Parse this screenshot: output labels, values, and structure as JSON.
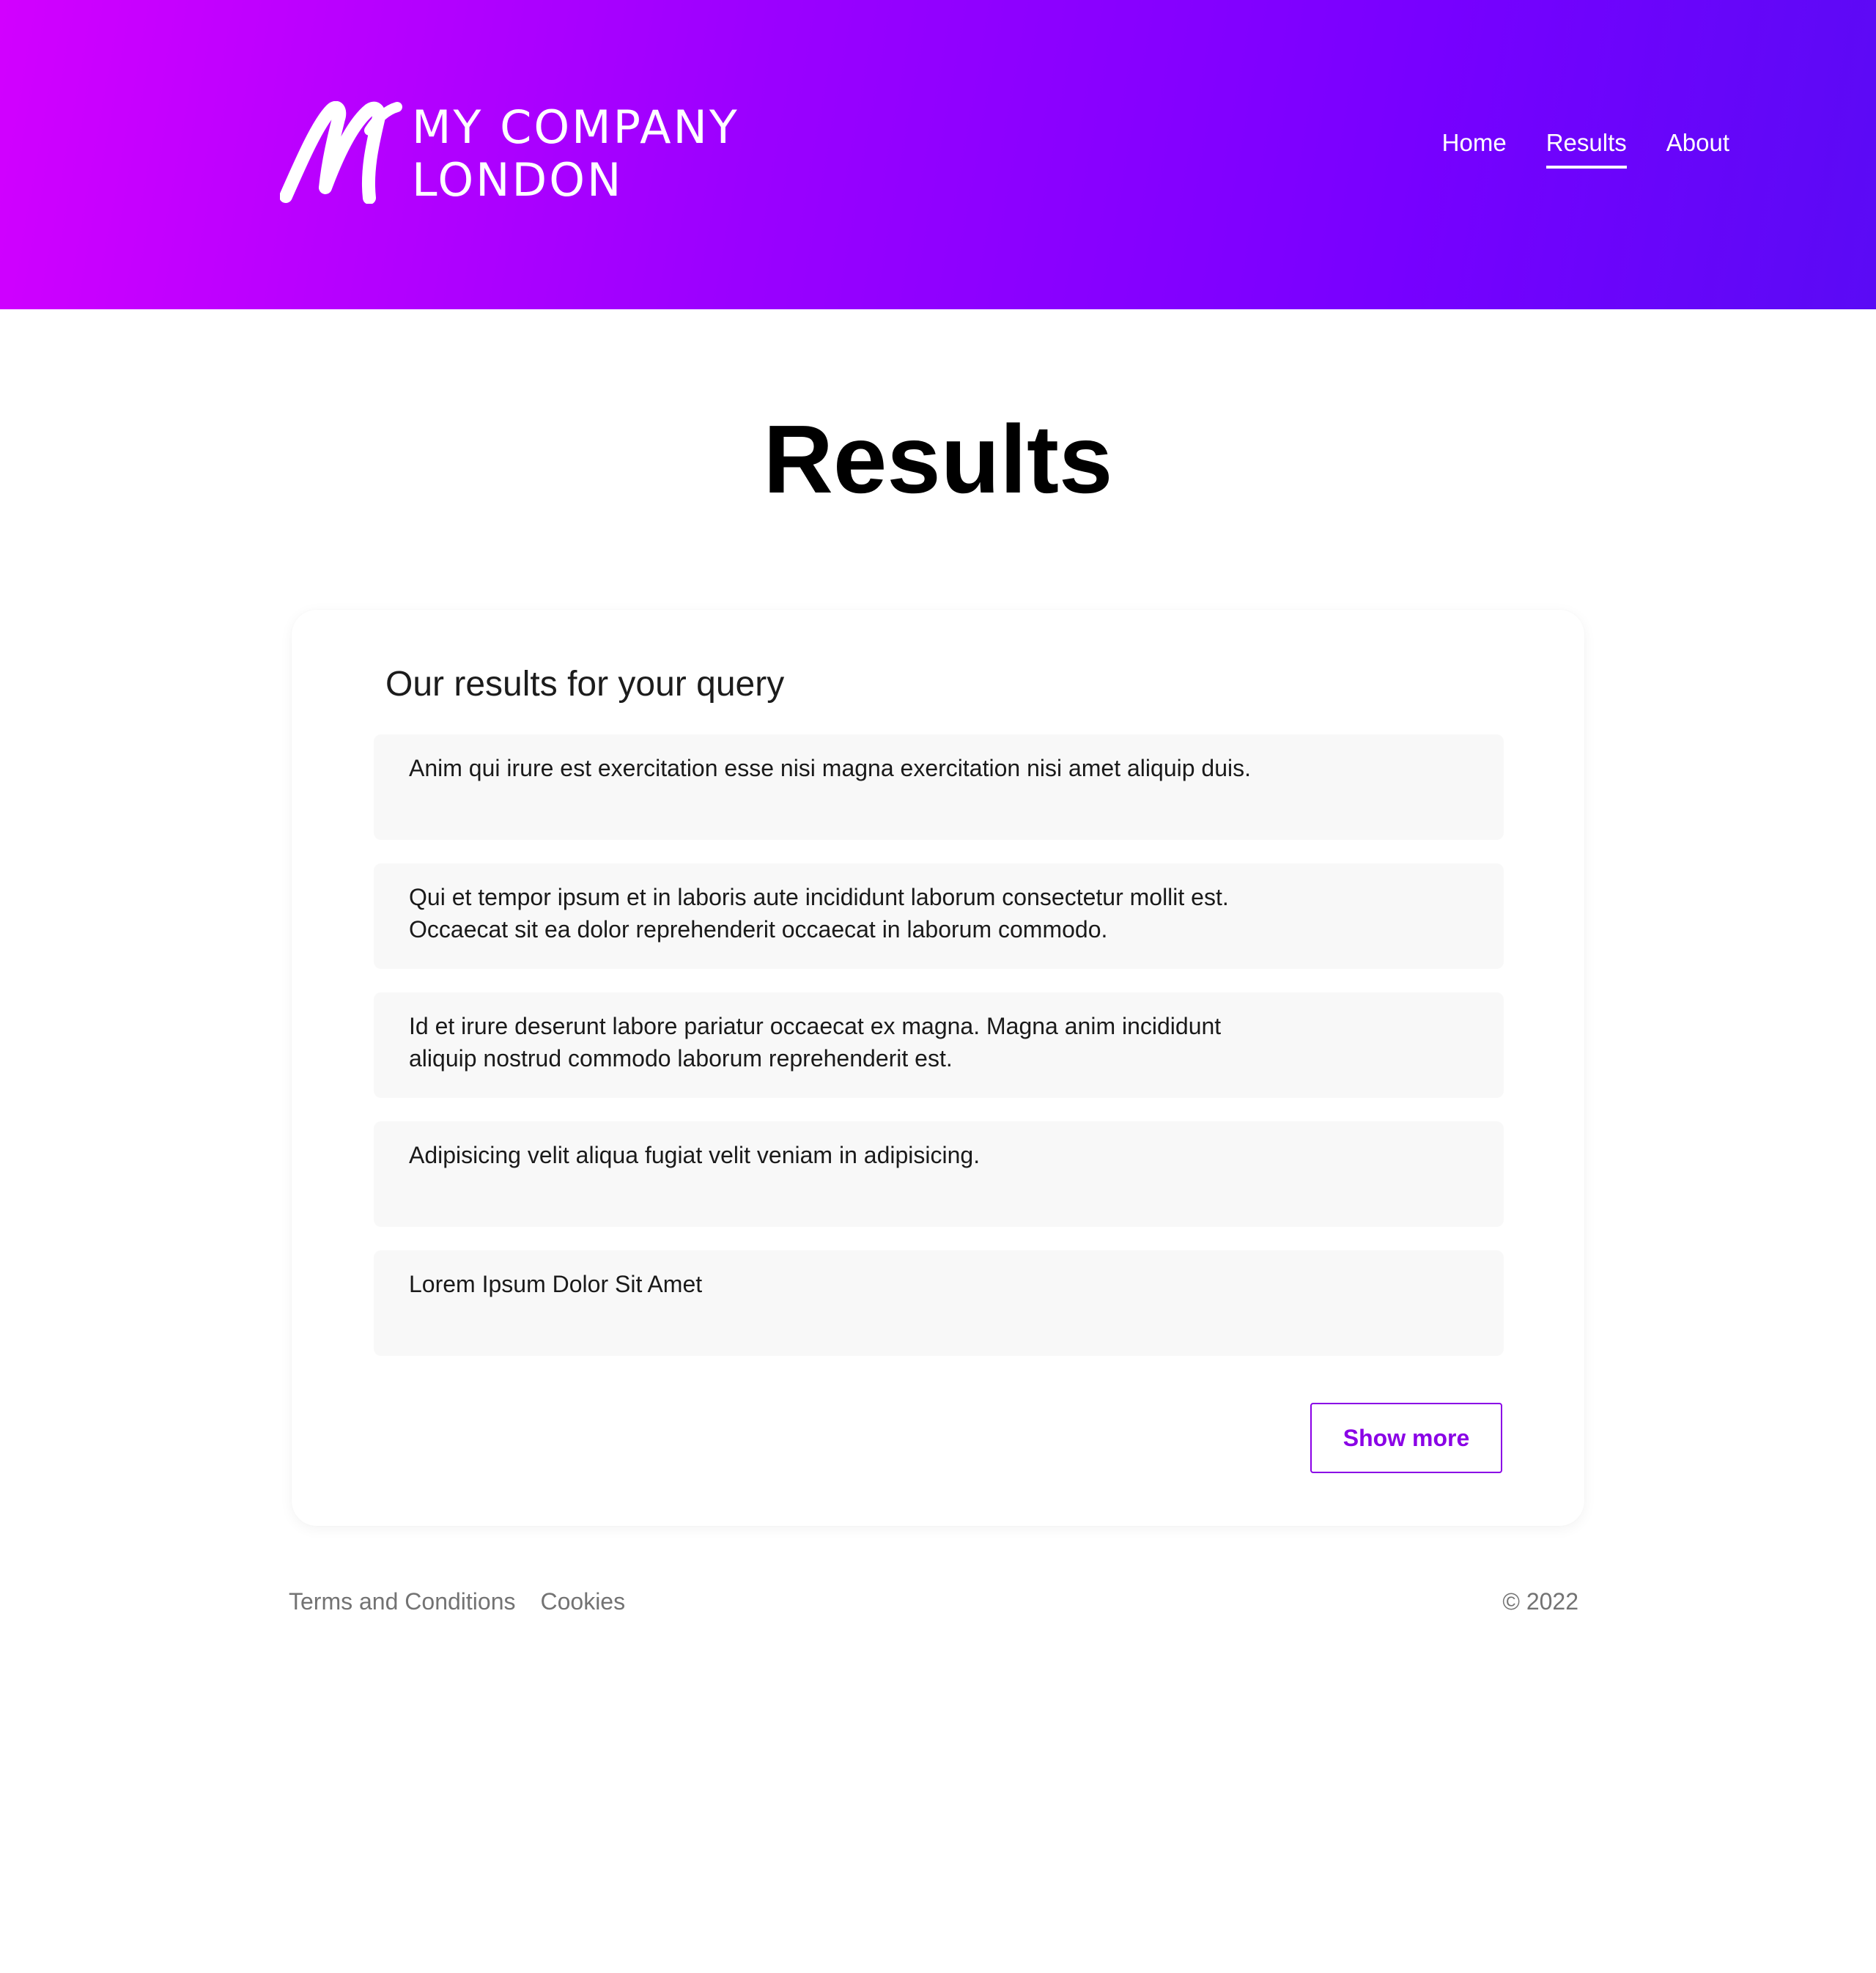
{
  "header": {
    "logo_line1": "MY COMPANY",
    "logo_line2": "LONDON",
    "nav": [
      {
        "label": "Home",
        "active": false
      },
      {
        "label": "Results",
        "active": true
      },
      {
        "label": "About",
        "active": false
      }
    ],
    "gradient_start": "#d200ff",
    "gradient_end": "#5a0af5"
  },
  "main": {
    "title": "Results",
    "card_title": "Our results for your query",
    "results": [
      "Anim qui irure est exercitation esse nisi magna exercitation nisi amet aliquip duis.",
      "Qui et tempor ipsum et in laboris aute incididunt laborum consectetur mollit est. Occaecat sit ea dolor reprehenderit occaecat in laborum commodo.",
      "Id et irure deserunt labore pariatur occaecat ex magna. Magna anim incididunt aliquip nostrud commodo laborum reprehenderit est.",
      "Adipisicing velit aliqua fugiat velit veniam in adipisicing.",
      "Lorem Ipsum Dolor Sit Amet"
    ],
    "show_more_label": "Show more",
    "accent_color": "#8a00e6"
  },
  "footer": {
    "links": [
      "Terms and Conditions",
      "Cookies"
    ],
    "copyright": "© 2022"
  },
  "icons": {
    "logo": "m-script-logo-icon"
  }
}
